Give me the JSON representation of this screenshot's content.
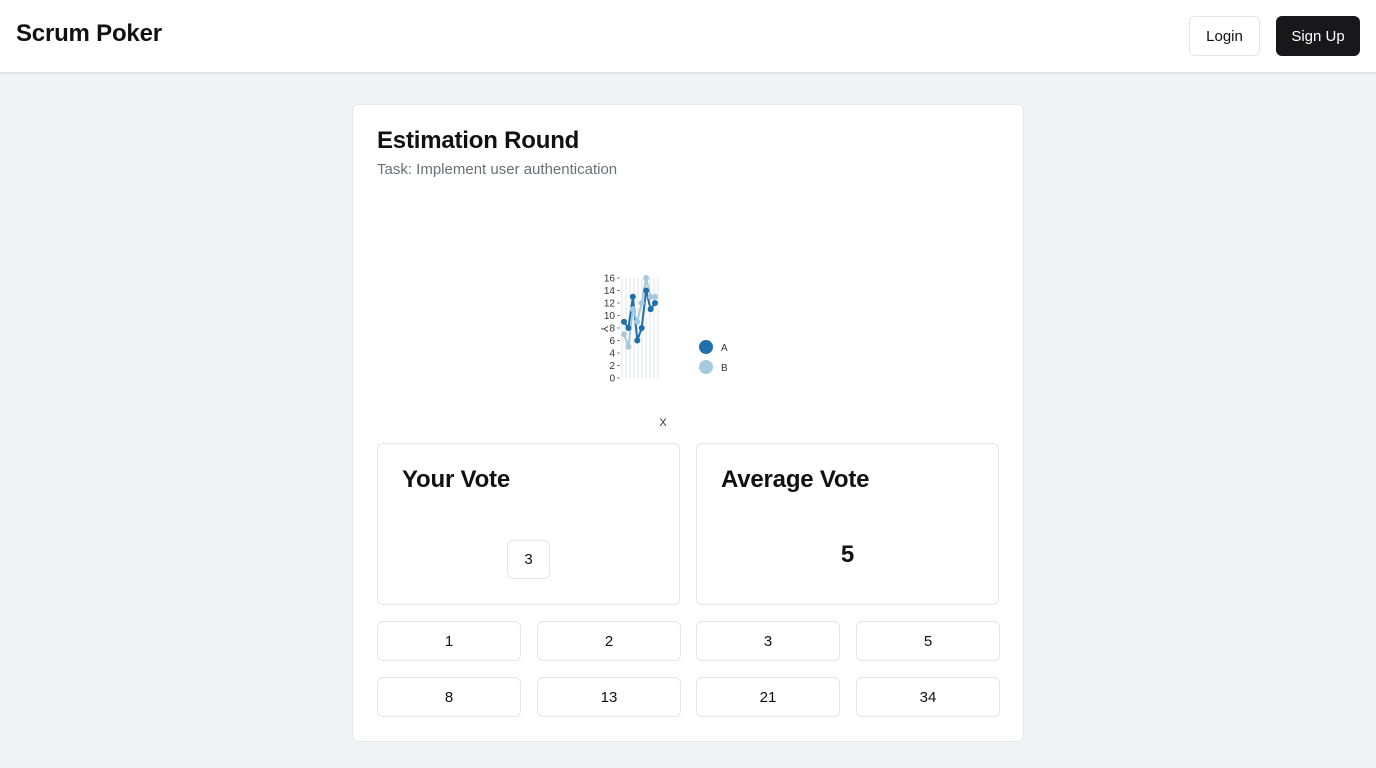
{
  "header": {
    "brand": "Scrum Poker",
    "login_label": "Login",
    "signup_label": "Sign Up"
  },
  "round": {
    "title": "Estimation Round",
    "task": "Task: Implement user authentication"
  },
  "chart_data": {
    "type": "line",
    "xlabel": "X",
    "ylabel": "Y",
    "ylim": [
      0,
      16
    ],
    "y_ticks": [
      "0",
      "2",
      "4",
      "6",
      "8",
      "10",
      "12",
      "14",
      "16"
    ],
    "x_count": 10,
    "legend_position": "right",
    "series": [
      {
        "name": "A",
        "color": "#1f6fad",
        "values": [
          9,
          8,
          13,
          6,
          8,
          14,
          11,
          12
        ]
      },
      {
        "name": "B",
        "color": "#a6c9e0",
        "values": [
          7,
          5,
          11,
          9,
          12,
          16,
          13,
          13
        ]
      }
    ]
  },
  "your_vote": {
    "title": "Your Vote",
    "value": "3"
  },
  "average_vote": {
    "title": "Average Vote",
    "value": "5"
  },
  "vote_options": [
    "1",
    "2",
    "3",
    "5",
    "8",
    "13",
    "21",
    "34"
  ]
}
